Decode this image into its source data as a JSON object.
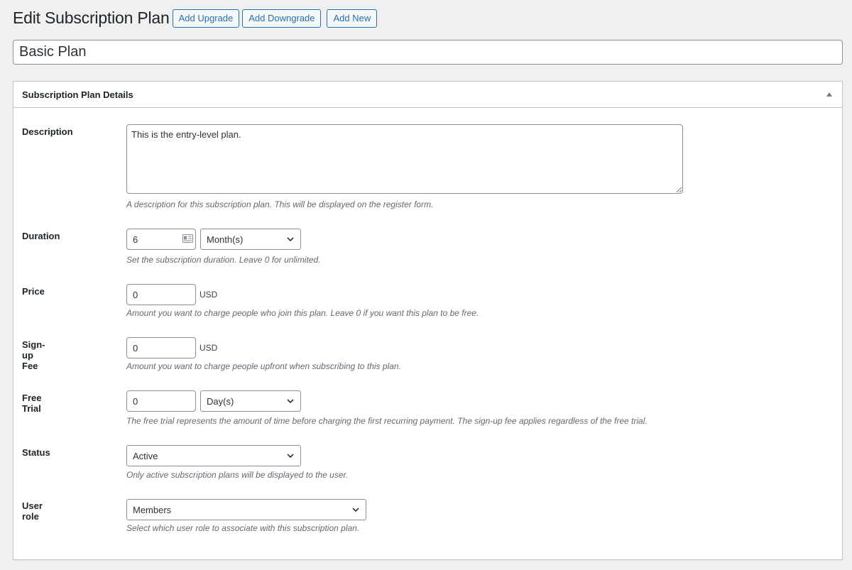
{
  "header": {
    "title": "Edit Subscription Plan",
    "buttons": {
      "add_upgrade": "Add Upgrade",
      "add_downgrade": "Add Downgrade",
      "add_new": "Add New"
    }
  },
  "plan_title": "Basic Plan",
  "postbox": {
    "title": "Subscription Plan Details",
    "toggle_icon": "triangle-up-icon"
  },
  "fields": {
    "description": {
      "label": "Description",
      "value": "This is the entry-level plan.",
      "help": "A description for this subscription plan. This will be displayed on the register form."
    },
    "duration": {
      "label": "Duration",
      "value": "6",
      "unit_selected": "Month(s)",
      "help": "Set the subscription duration. Leave 0 for unlimited."
    },
    "price": {
      "label": "Price",
      "value": "0",
      "currency": "USD",
      "help": "Amount you want to charge people who join this plan. Leave 0 if you want this plan to be free."
    },
    "signup_fee": {
      "label": "Sign-up Fee",
      "value": "0",
      "currency": "USD",
      "help": "Amount you want to charge people upfront when subscribing to this plan."
    },
    "free_trial": {
      "label": "Free Trial",
      "value": "0",
      "unit_selected": "Day(s)",
      "help": "The free trial represents the amount of time before charging the first recurring payment. The sign-up fee applies regardless of the free trial."
    },
    "status": {
      "label": "Status",
      "selected": "Active",
      "help": "Only active subscription plans will be displayed to the user."
    },
    "user_role": {
      "label": "User role",
      "selected": "Members",
      "help": "Select which user role to associate with this subscription plan."
    }
  },
  "colors": {
    "accent": "#2271b1",
    "background": "#f0f0f1",
    "help_text": "#646970"
  }
}
